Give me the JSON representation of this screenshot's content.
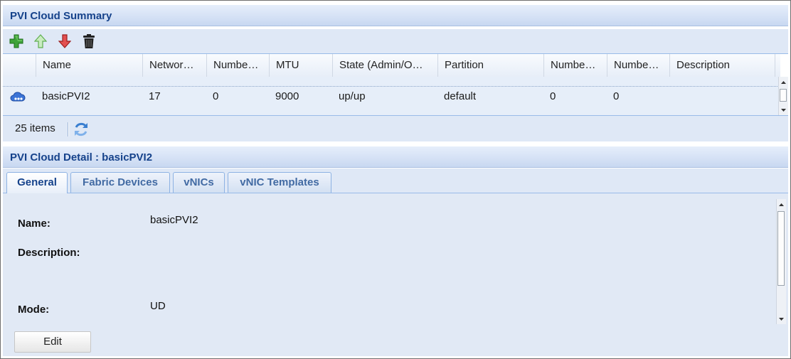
{
  "summary": {
    "title": "PVI Cloud Summary",
    "toolbar": {
      "add": "add-icon",
      "move_up": "arrow-up-icon",
      "move_down": "arrow-down-icon",
      "delete": "trash-icon"
    },
    "columns": [
      "Name",
      "Networ…",
      "Numbe…",
      "MTU",
      "State (Admin/O…",
      "Partition",
      "Numbe…",
      "Numbe…",
      "Description"
    ],
    "rows": [
      {
        "icon": "cloud-network-icon",
        "cells": [
          "basicPVI2",
          "17",
          "0",
          "9000",
          "up/up",
          "default",
          "0",
          "0",
          ""
        ]
      }
    ],
    "items_count": "25 items",
    "refresh": "refresh-icon"
  },
  "detail": {
    "title": "PVI Cloud Detail : basicPVI2",
    "tabs": [
      "General",
      "Fabric Devices",
      "vNICs",
      "vNIC Templates"
    ],
    "active_tab": "General",
    "fields": {
      "name_label": "Name:",
      "name_value": "basicPVI2",
      "description_label": "Description:",
      "description_value": "",
      "mode_label": "Mode:",
      "mode_value": "UD"
    },
    "edit_label": "Edit"
  },
  "colors": {
    "title_text": "#15428b",
    "toolbar_bg": "#dfe8f6",
    "row_bg": "#e6eef9",
    "border": "#99bbe8"
  }
}
